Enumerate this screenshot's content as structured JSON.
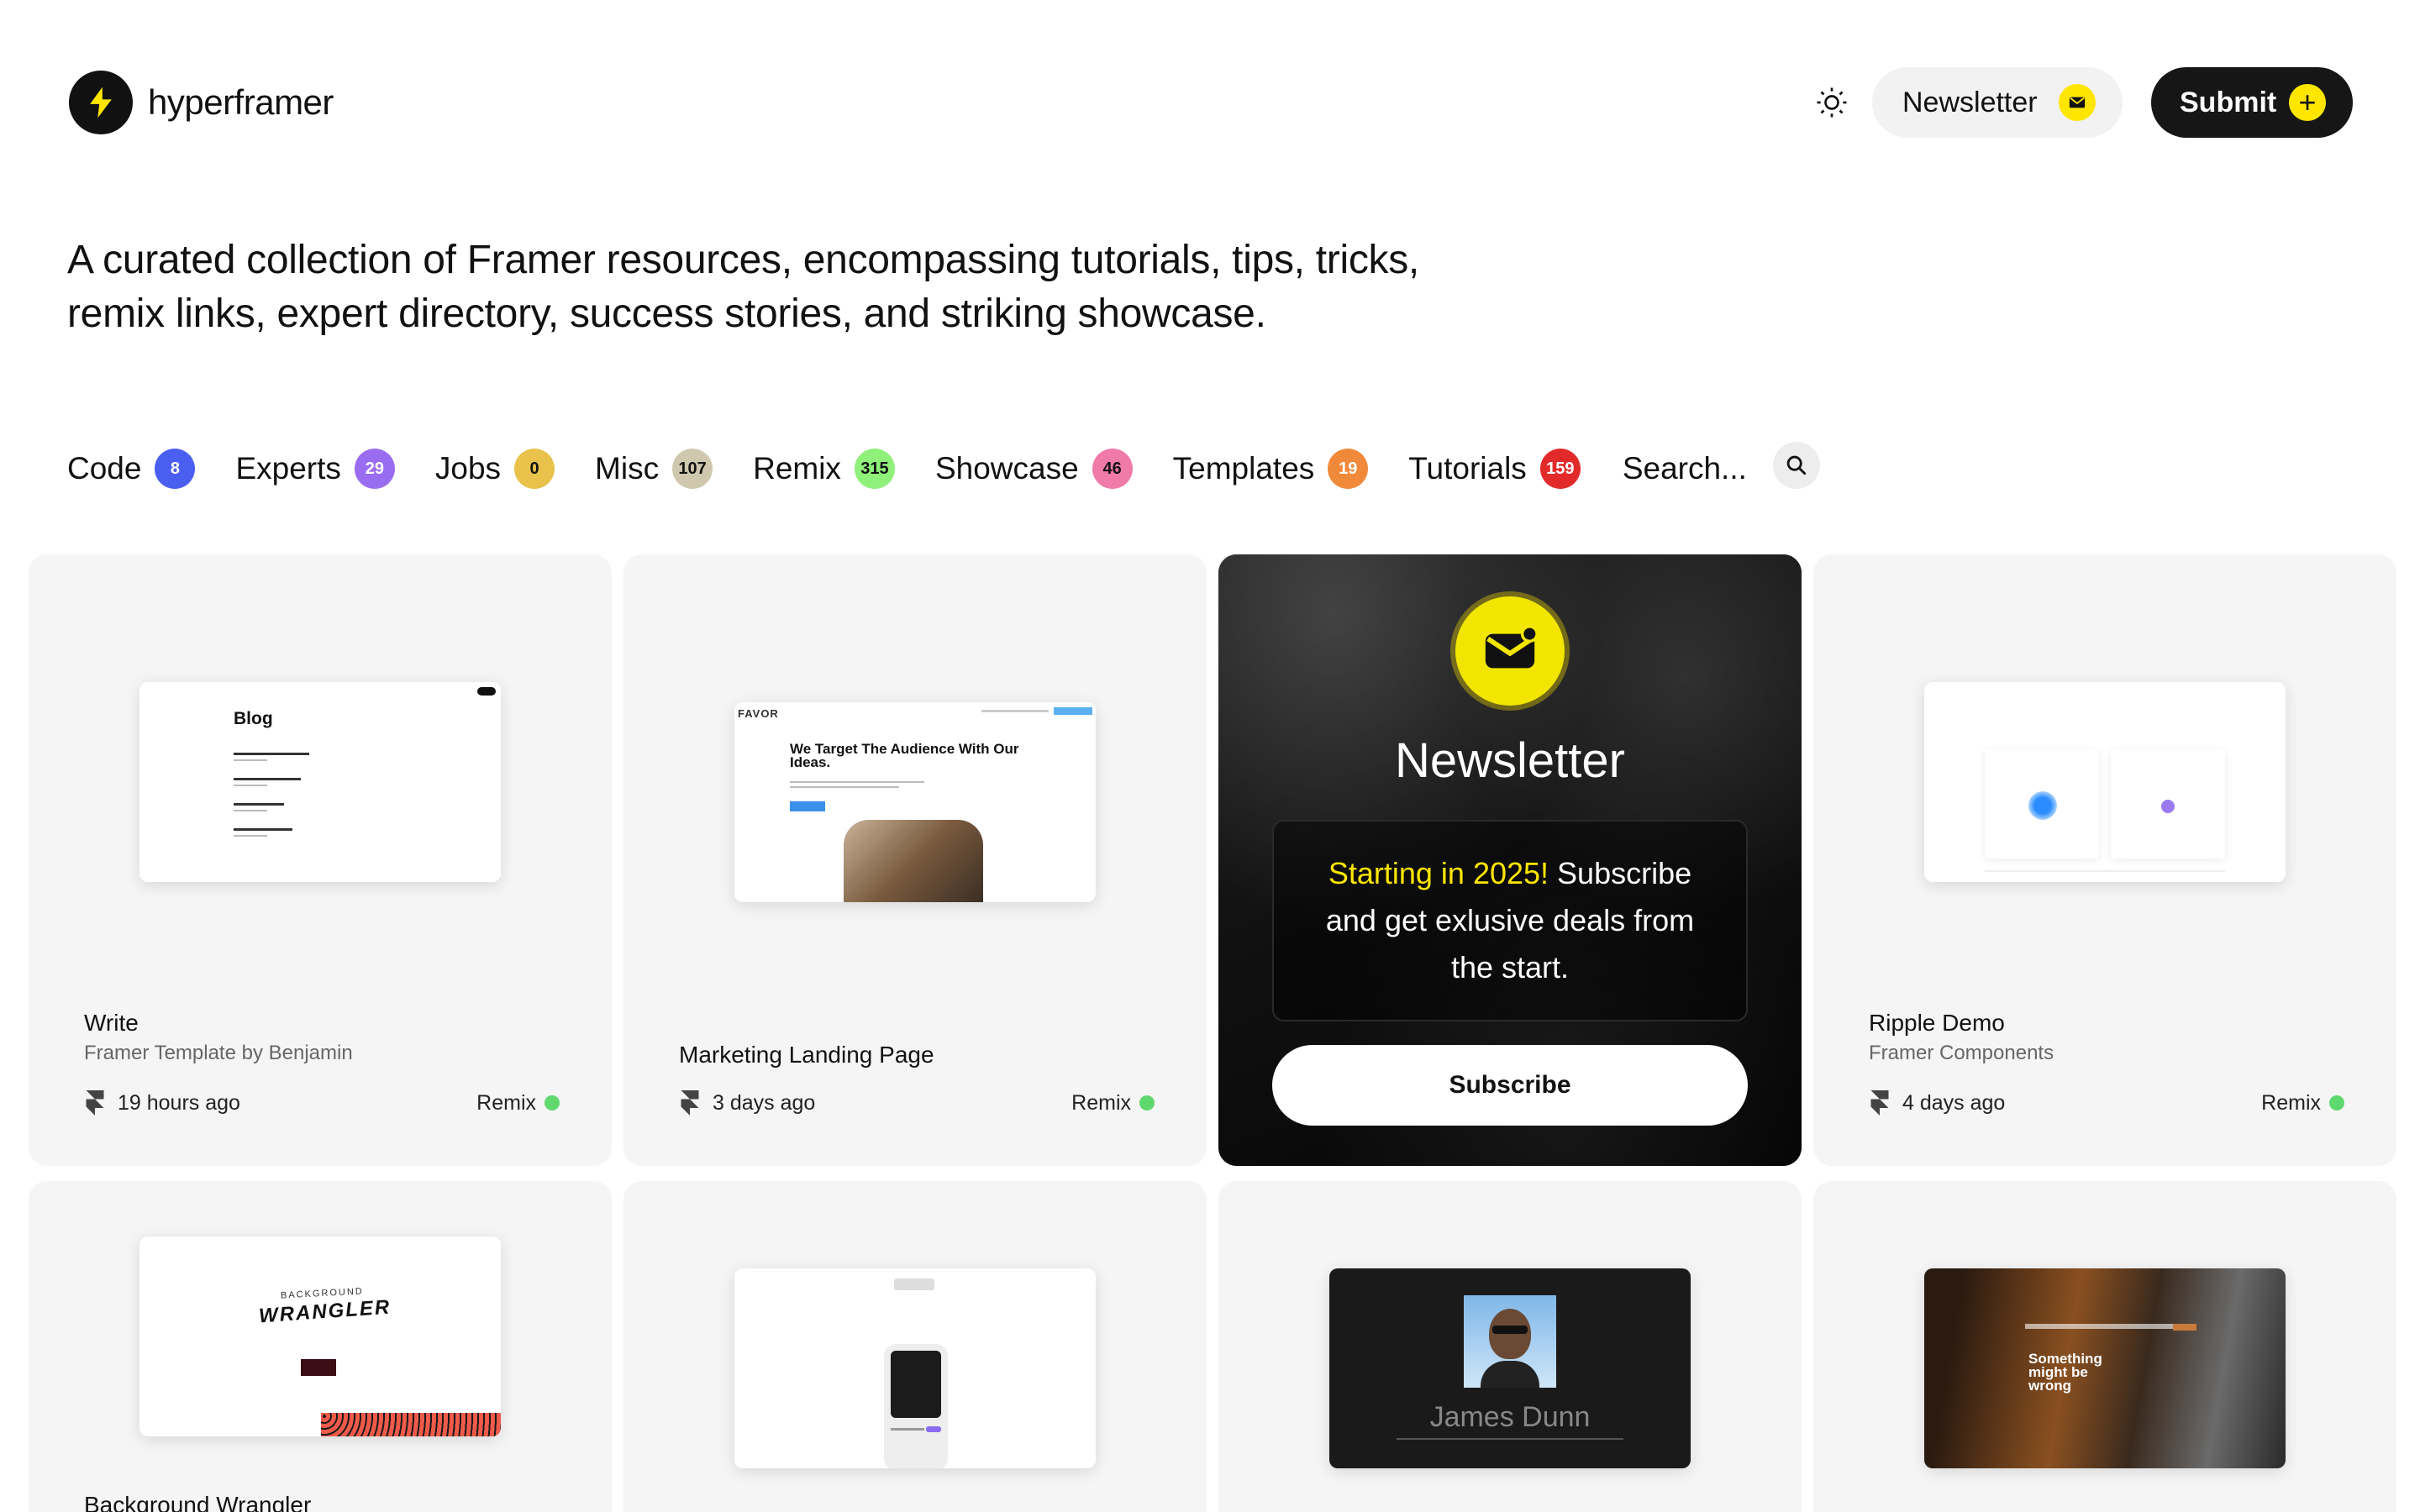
{
  "brand": {
    "name": "hyperframer"
  },
  "header": {
    "newsletter_label": "Newsletter",
    "submit_label": "Submit"
  },
  "tagline": "A curated collection of Framer resources, encompassing tutorials, tips, tricks, remix links, expert directory, success stories, and striking showcase.",
  "filters": [
    {
      "label": "Code",
      "count": "8",
      "color": "#4a5ff0"
    },
    {
      "label": "Experts",
      "count": "29",
      "color": "#9a6cf0"
    },
    {
      "label": "Jobs",
      "count": "0",
      "color": "#e8c24a"
    },
    {
      "label": "Misc",
      "count": "107",
      "color": "#c9c2a8"
    },
    {
      "label": "Remix",
      "count": "315",
      "color": "#8ff07a"
    },
    {
      "label": "Showcase",
      "count": "46",
      "color": "#f07aa8"
    },
    {
      "label": "Templates",
      "count": "19",
      "color": "#f08a3a"
    },
    {
      "label": "Tutorials",
      "count": "159",
      "color": "#e83a3a"
    }
  ],
  "search": {
    "placeholder": "Search..."
  },
  "cards": [
    {
      "title": "Write",
      "subtitle": "Framer Template by Benjamin",
      "time": "19 hours ago",
      "tag": "Remix",
      "thumb_heading": "Blog"
    },
    {
      "title": "Marketing Landing Page",
      "subtitle": "",
      "time": "3 days ago",
      "tag": "Remix",
      "thumb_brand": "FAVOR",
      "thumb_heading": "We Target The Audience With Our Ideas."
    },
    {
      "title": "Ripple Demo",
      "subtitle": "Framer Components",
      "time": "4 days ago",
      "tag": "Remix"
    },
    {
      "title": "Background Wrangler",
      "thumb_heading": "WRANGLER",
      "thumb_small": "BACKGROUND"
    },
    {
      "title": ""
    },
    {
      "title": "",
      "thumb_name": "James Dunn"
    },
    {
      "title": "",
      "thumb_heading": "Something might be wrong"
    }
  ],
  "newsletter_card": {
    "title": "Newsletter",
    "highlight": "Starting in 2025!",
    "body": " Subscribe and get exlusive deals from the start.",
    "button": "Subscribe"
  },
  "colors": {
    "accent": "#ffe600",
    "dark": "#161616",
    "remix_dot": "#5fd86e"
  }
}
